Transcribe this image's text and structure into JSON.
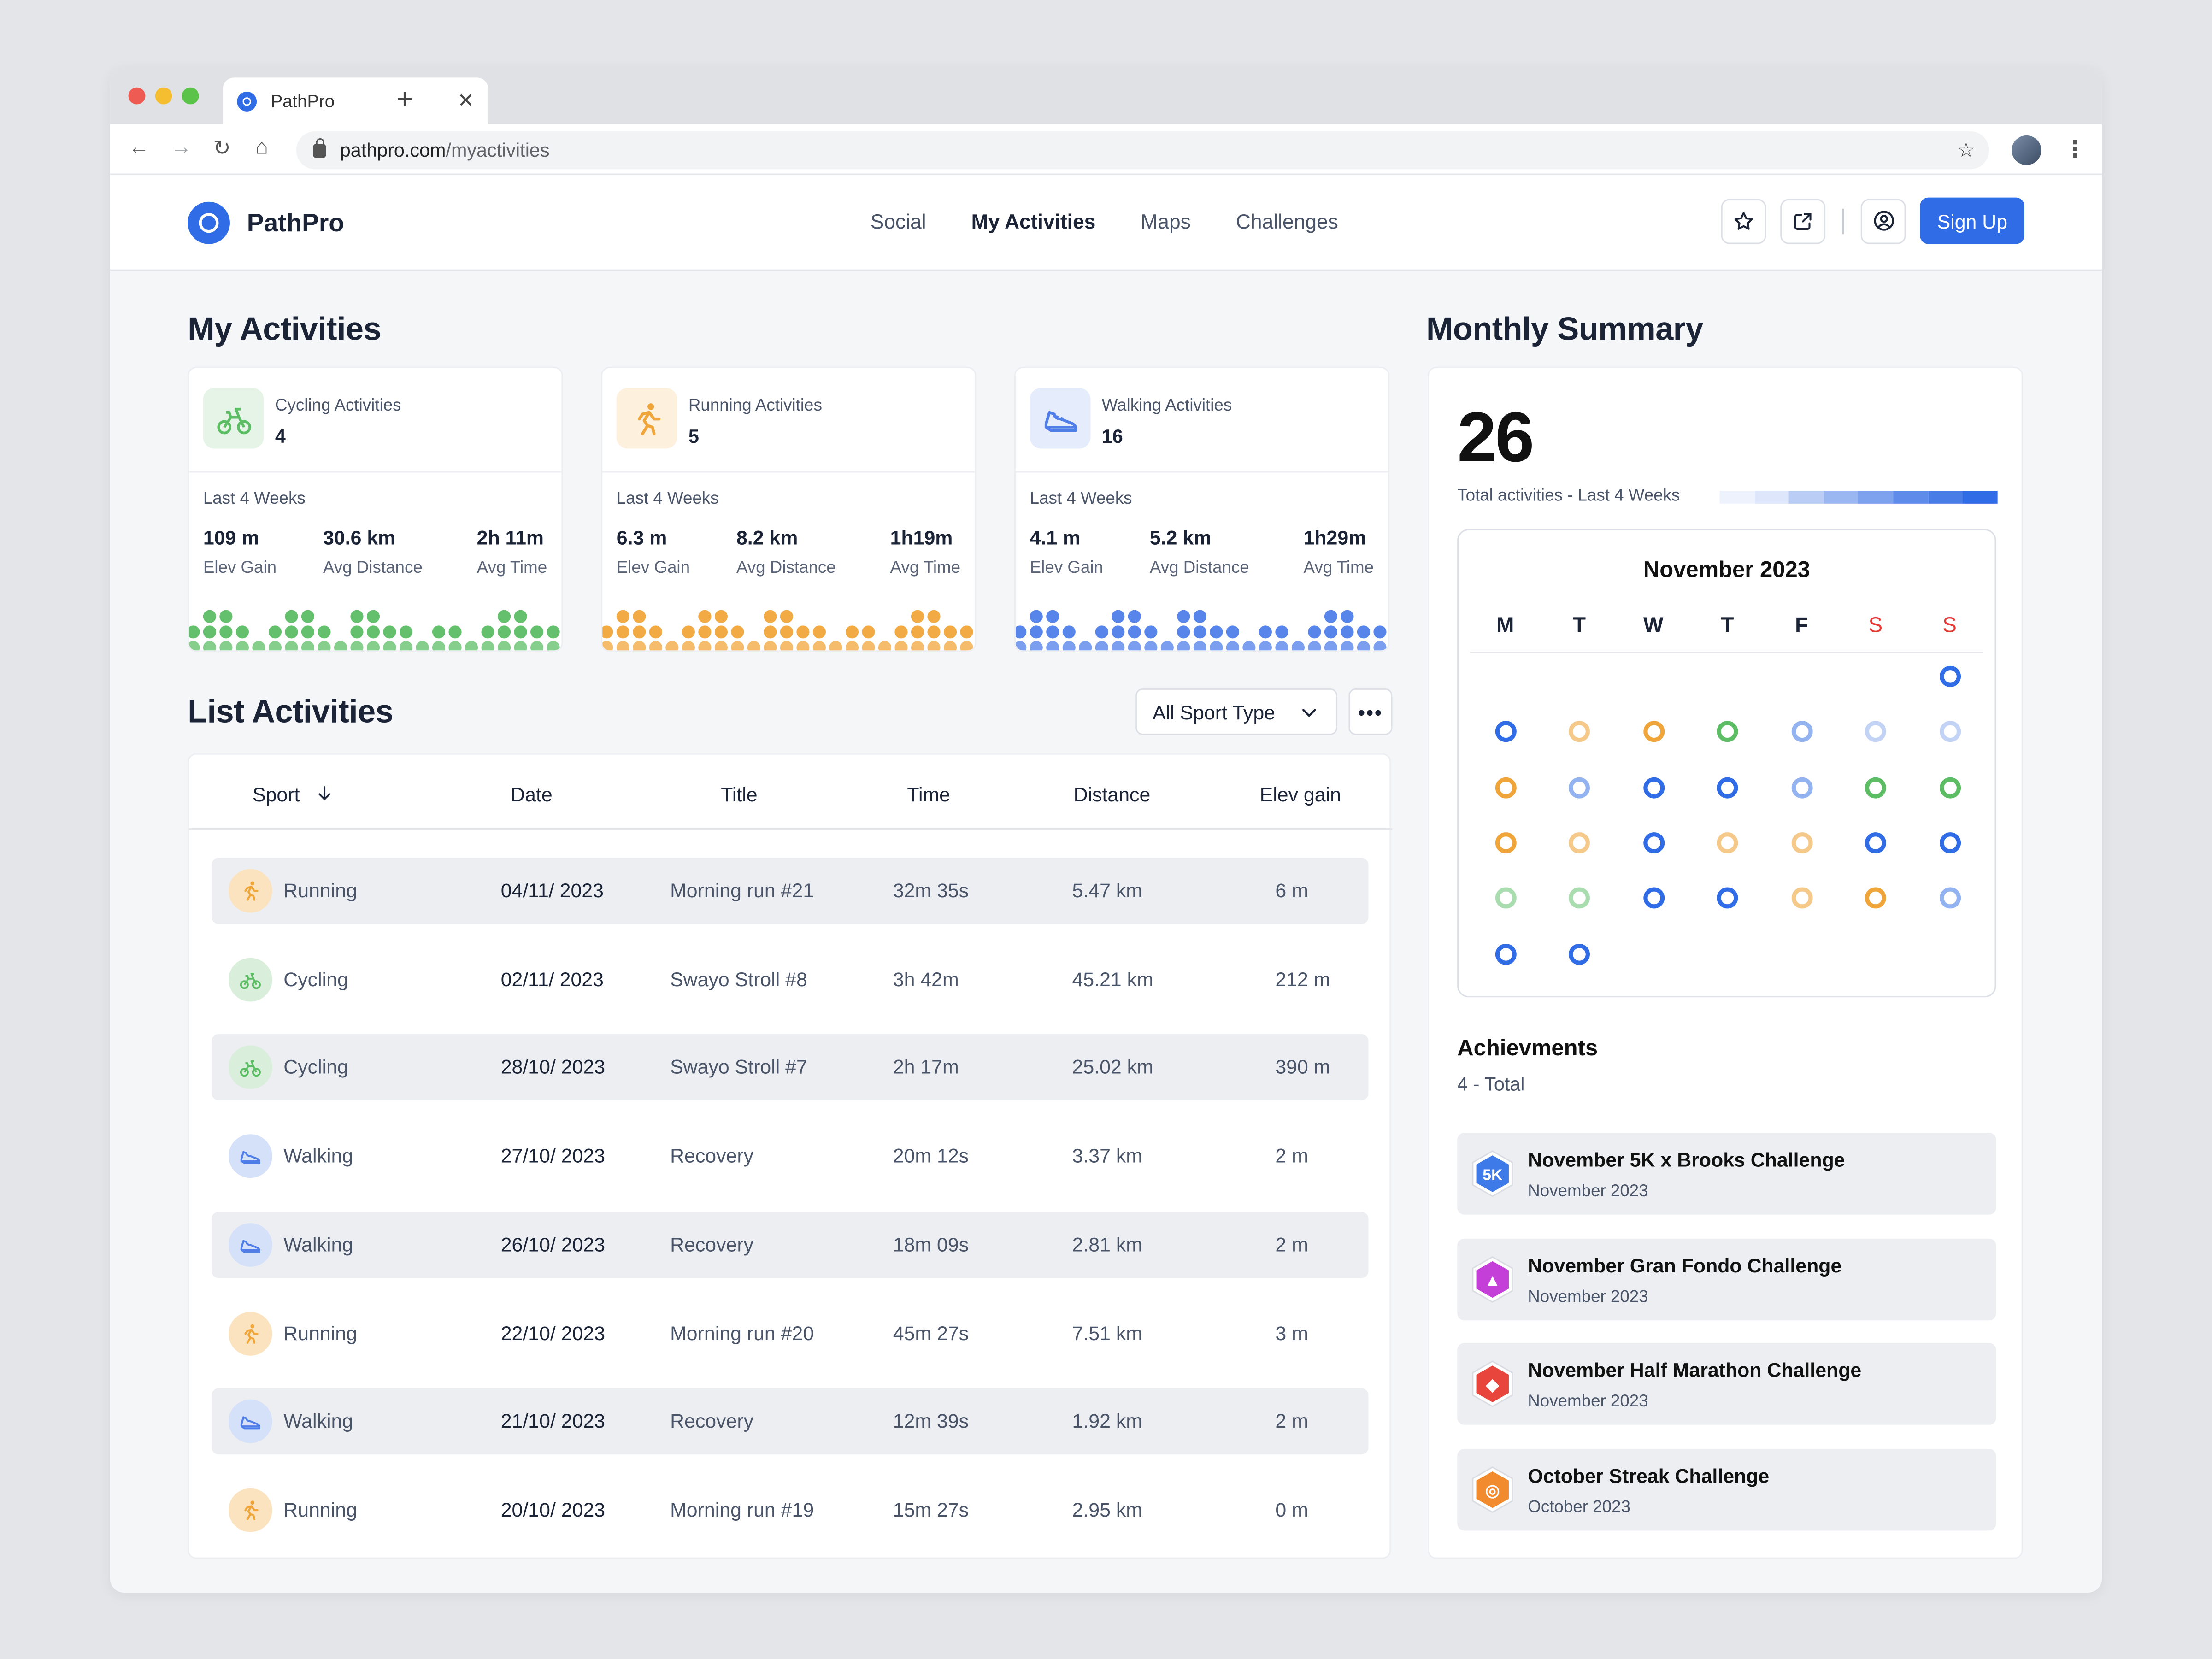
{
  "browser": {
    "tab_title": "PathPro",
    "url_host": "pathpro.com",
    "url_path": "/myactivities"
  },
  "app": {
    "name": "PathPro",
    "nav": [
      "Social",
      "My Activities",
      "Maps",
      "Challenges"
    ],
    "active_nav": "My Activities",
    "signup_label": "Sign Up"
  },
  "my_activities": {
    "title": "My Activities",
    "cards": [
      {
        "label": "Cycling Activities",
        "count": "4",
        "period": "Last 4 Weeks",
        "icon": "bike-icon",
        "metrics": [
          {
            "v": "109 m",
            "k": "Elev Gain"
          },
          {
            "v": "30.6 km",
            "k": "Avg Distance"
          },
          {
            "v": "2h 11m",
            "k": "Avg Time"
          }
        ],
        "color": "#5cbd64",
        "bg": "#e6f4e7"
      },
      {
        "label": "Running Activities",
        "count": "5",
        "period": "Last 4 Weeks",
        "icon": "runner-icon",
        "metrics": [
          {
            "v": "6.3 m",
            "k": "Elev Gain"
          },
          {
            "v": "8.2 km",
            "k": "Avg Distance"
          },
          {
            "v": "1h19m",
            "k": "Avg Time"
          }
        ],
        "color": "#f0a53a",
        "bg": "#fdf0dc"
      },
      {
        "label": "Walking Activities",
        "count": "16",
        "period": "Last 4 Weeks",
        "icon": "shoe-icon",
        "metrics": [
          {
            "v": "4.1 m",
            "k": "Elev Gain"
          },
          {
            "v": "5.2 km",
            "k": "Avg Distance"
          },
          {
            "v": "1h29m",
            "k": "Avg Time"
          }
        ],
        "color": "#4f7ee8",
        "bg": "#e5ecfb"
      }
    ]
  },
  "list": {
    "title": "List Activities",
    "filter": "All Sport Type",
    "columns": [
      "Sport",
      "Date",
      "Title",
      "Time",
      "Distance",
      "Elev gain"
    ],
    "rows": [
      {
        "sport": "Running",
        "date": "04/11/ 2023",
        "title": "Morning run #21",
        "time": "32m 35s",
        "distance": "5.47 km",
        "elev": "6 m"
      },
      {
        "sport": "Cycling",
        "date": "02/11/ 2023",
        "title": "Swayo Stroll #8",
        "time": "3h 42m",
        "distance": "45.21 km",
        "elev": "212 m"
      },
      {
        "sport": "Cycling",
        "date": "28/10/ 2023",
        "title": "Swayo Stroll #7",
        "time": "2h 17m",
        "distance": "25.02 km",
        "elev": "390 m"
      },
      {
        "sport": "Walking",
        "date": "27/10/ 2023",
        "title": "Recovery",
        "time": "20m 12s",
        "distance": "3.37 km",
        "elev": "2 m"
      },
      {
        "sport": "Walking",
        "date": "26/10/ 2023",
        "title": "Recovery",
        "time": "18m 09s",
        "distance": "2.81 km",
        "elev": "2 m"
      },
      {
        "sport": "Running",
        "date": "22/10/ 2023",
        "title": "Morning run #20",
        "time": "45m 27s",
        "distance": "7.51 km",
        "elev": "3 m"
      },
      {
        "sport": "Walking",
        "date": "21/10/ 2023",
        "title": "Recovery",
        "time": "12m 39s",
        "distance": "1.92 km",
        "elev": "2 m"
      },
      {
        "sport": "Running",
        "date": "20/10/ 2023",
        "title": "Morning run #19",
        "time": "15m 27s",
        "distance": "2.95 km",
        "elev": "0 m"
      }
    ]
  },
  "summary": {
    "title": "Monthly Summary",
    "total": "26",
    "subtitle": "Total activities - Last 4 Weeks",
    "calendar": {
      "month": "November  2023",
      "weekdays": [
        "M",
        "T",
        "W",
        "T",
        "F",
        "S",
        "S"
      ],
      "rings": [
        [
          null,
          null,
          null,
          null,
          null,
          null,
          "#2f6ce6"
        ],
        [
          "#2f6ce6",
          "#f5c98a",
          "#f0a53a",
          "#5cbd64",
          "#93b3f0",
          "#c2d3f5",
          "#c2d3f5"
        ],
        [
          "#f0a53a",
          "#93b3f0",
          "#2f6ce6",
          "#2f6ce6",
          "#93b3f0",
          "#5cbd64",
          "#5cbd64"
        ],
        [
          "#f0a53a",
          "#f5c98a",
          "#2f6ce6",
          "#f5c98a",
          "#f5c98a",
          "#2f6ce6",
          "#2f6ce6"
        ],
        [
          "#a9dcae",
          "#a9dcae",
          "#2f6ce6",
          "#2f6ce6",
          "#f5c98a",
          "#f0a53a",
          "#93b3f0"
        ],
        [
          "#2f6ce6",
          "#2f6ce6",
          null,
          null,
          null,
          null,
          null
        ]
      ]
    },
    "achievements_title": "Achievments",
    "achievements_count": "4 - Total",
    "achievements": [
      {
        "title": "November 5K x Brooks Challenge",
        "date": "November 2023",
        "icon": "5k-badge-icon",
        "color": "#3f7be8",
        "glyph": "5K"
      },
      {
        "title": "November Gran Fondo Challenge",
        "date": "November 2023",
        "icon": "mountain-badge-icon",
        "color": "#c43fd8",
        "glyph": "▲"
      },
      {
        "title": "November Half Marathon Challenge",
        "date": "November 2023",
        "icon": "gem-badge-icon",
        "color": "#e8453c",
        "glyph": "◆"
      },
      {
        "title": "October Streak Challenge",
        "date": "October 2023",
        "icon": "target-badge-icon",
        "color": "#f28a2e",
        "glyph": "◎"
      }
    ]
  }
}
